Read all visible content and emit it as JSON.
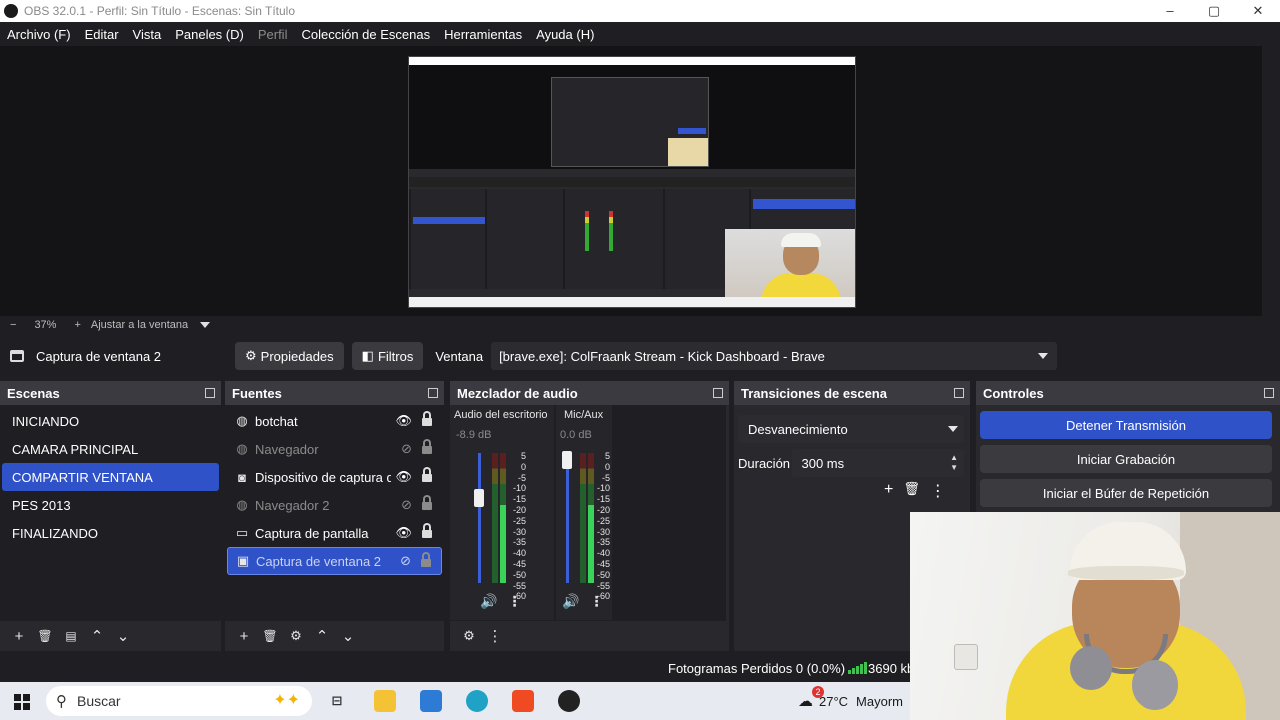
{
  "window": {
    "title": "OBS 32.0.1 - Perfil: Sin Título - Escenas: Sin Título",
    "controls": {
      "minimize": "–",
      "maximize": "▢",
      "close": "✕"
    }
  },
  "menu": [
    {
      "label": "Archivo (F)",
      "enabled": true
    },
    {
      "label": "Editar",
      "enabled": true
    },
    {
      "label": "Vista",
      "enabled": true
    },
    {
      "label": "Paneles (D)",
      "enabled": true
    },
    {
      "label": "Perfil",
      "enabled": false
    },
    {
      "label": "Colección de Escenas",
      "enabled": true
    },
    {
      "label": "Herramientas",
      "enabled": true
    },
    {
      "label": "Ayuda (H)",
      "enabled": true
    }
  ],
  "zoom": {
    "minus": "−",
    "level": "37%",
    "plus": "+",
    "fit_label": "Ajustar a la ventana"
  },
  "source_toolbar": {
    "selected_source": "Captura de ventana 2",
    "properties_label": "Propiedades",
    "filters_label": "Filtros",
    "window_label": "Ventana",
    "window_value": "[brave.exe]: ColFraank Stream - Kick Dashboard - Brave"
  },
  "scenes": {
    "title": "Escenas",
    "items": [
      {
        "label": "INICIANDO",
        "selected": false
      },
      {
        "label": "CAMARA PRINCIPAL",
        "selected": false
      },
      {
        "label": "COMPARTIR VENTANA",
        "selected": true
      },
      {
        "label": "PES 2013",
        "selected": false
      },
      {
        "label": "FINALIZANDO",
        "selected": false
      }
    ],
    "footer": {
      "add": "+",
      "remove": "🗑",
      "filters": "▤",
      "up": "⌃",
      "down": "⌄"
    }
  },
  "sources": {
    "title": "Fuentes",
    "items": [
      {
        "label": "botchat",
        "icon": "globe-icon",
        "visible": true,
        "selected": false
      },
      {
        "label": "Navegador",
        "icon": "globe-icon",
        "visible": false,
        "selected": false
      },
      {
        "label": "Dispositivo de captura d",
        "icon": "camera-icon",
        "visible": true,
        "selected": false
      },
      {
        "label": "Navegador 2",
        "icon": "globe-icon",
        "visible": false,
        "selected": false
      },
      {
        "label": "Captura de pantalla",
        "icon": "monitor-icon",
        "visible": true,
        "selected": false
      },
      {
        "label": "Captura de ventana 2",
        "icon": "window-icon",
        "visible": false,
        "selected": true
      }
    ],
    "footer": {
      "add": "+",
      "remove": "🗑",
      "settings": "⚙",
      "up": "⌃",
      "down": "⌄"
    }
  },
  "mixer": {
    "title": "Mezclador de audio",
    "ticks": [
      "5",
      "0",
      "-5",
      "-10",
      "-15",
      "-20",
      "-25",
      "-30",
      "-35",
      "-40",
      "-45",
      "-50",
      "-55",
      "-60"
    ],
    "channels": [
      {
        "name": "Audio del escritorio",
        "db": "-8.9 dB"
      },
      {
        "name": "Mic/Aux",
        "db": "0.0 dB"
      }
    ],
    "footer": {
      "settings": "⚙",
      "menu": "⋮"
    }
  },
  "transitions": {
    "title": "Transiciones de escena",
    "selected": "Desvanecimiento",
    "duration_label": "Duración",
    "duration_value": "300 ms",
    "add": "+",
    "remove": "🗑",
    "menu": "⋮"
  },
  "controls": {
    "title": "Controles",
    "stop_stream": "Detener Transmisión",
    "start_recording": "Iniciar Grabación",
    "start_replay": "Iniciar el Búfer de Repetición"
  },
  "status": {
    "dropped_frames": "Fotogramas Perdidos 0 (0.0%)",
    "bitrate": "3690 kb"
  },
  "taskbar": {
    "search_placeholder": "Buscar",
    "weather_temp": "27°C",
    "weather_text": "Mayorm",
    "weather_badge": "2"
  },
  "colors": {
    "accent": "#2f52c8",
    "panel": "#28282d",
    "background": "#1f1f23",
    "meter_green": "#39d35a",
    "meter_yellow": "#a8a030",
    "meter_red": "#a02828"
  }
}
